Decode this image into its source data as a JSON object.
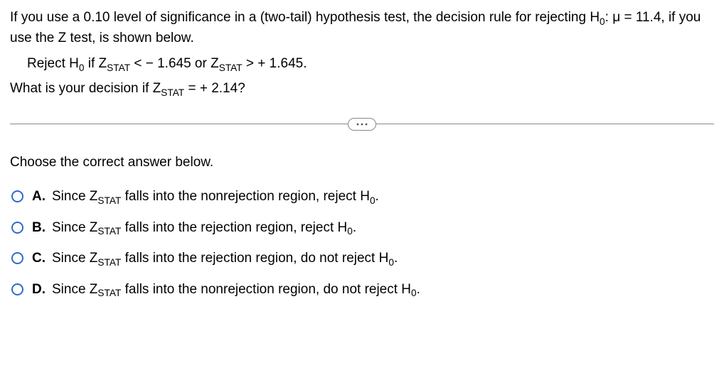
{
  "question": {
    "intro_1": "If you use a ",
    "alpha": "0.10",
    "intro_2": " level of significance in a (two-tail) hypothesis test, the decision rule for rejecting H",
    "intro_3": ": μ = ",
    "mu": "11.4",
    "intro_4": ", if you use the Z test, is shown below.",
    "rule_1": "Reject H",
    "rule_2": " if Z",
    "rule_3": " < − ",
    "crit": "1.645",
    "rule_4": " or Z",
    "rule_5": " > + ",
    "rule_6": ".",
    "q2_1": "What is your decision if Z",
    "q2_2": " = + ",
    "zstat": "2.14",
    "q2_3": "?",
    "prompt": "Choose the correct answer below."
  },
  "sub": {
    "zero": "0",
    "stat": "STAT"
  },
  "options": [
    {
      "letter": "A.",
      "t1": "Since Z",
      "t2": " falls into the nonrejection region, reject H",
      "t3": "."
    },
    {
      "letter": "B.",
      "t1": "Since Z",
      "t2": " falls into the rejection region, reject H",
      "t3": "."
    },
    {
      "letter": "C.",
      "t1": "Since Z",
      "t2": " falls into the rejection region, do not reject H",
      "t3": "."
    },
    {
      "letter": "D.",
      "t1": "Since Z",
      "t2": " falls into the nonrejection region, do not reject H",
      "t3": "."
    }
  ]
}
